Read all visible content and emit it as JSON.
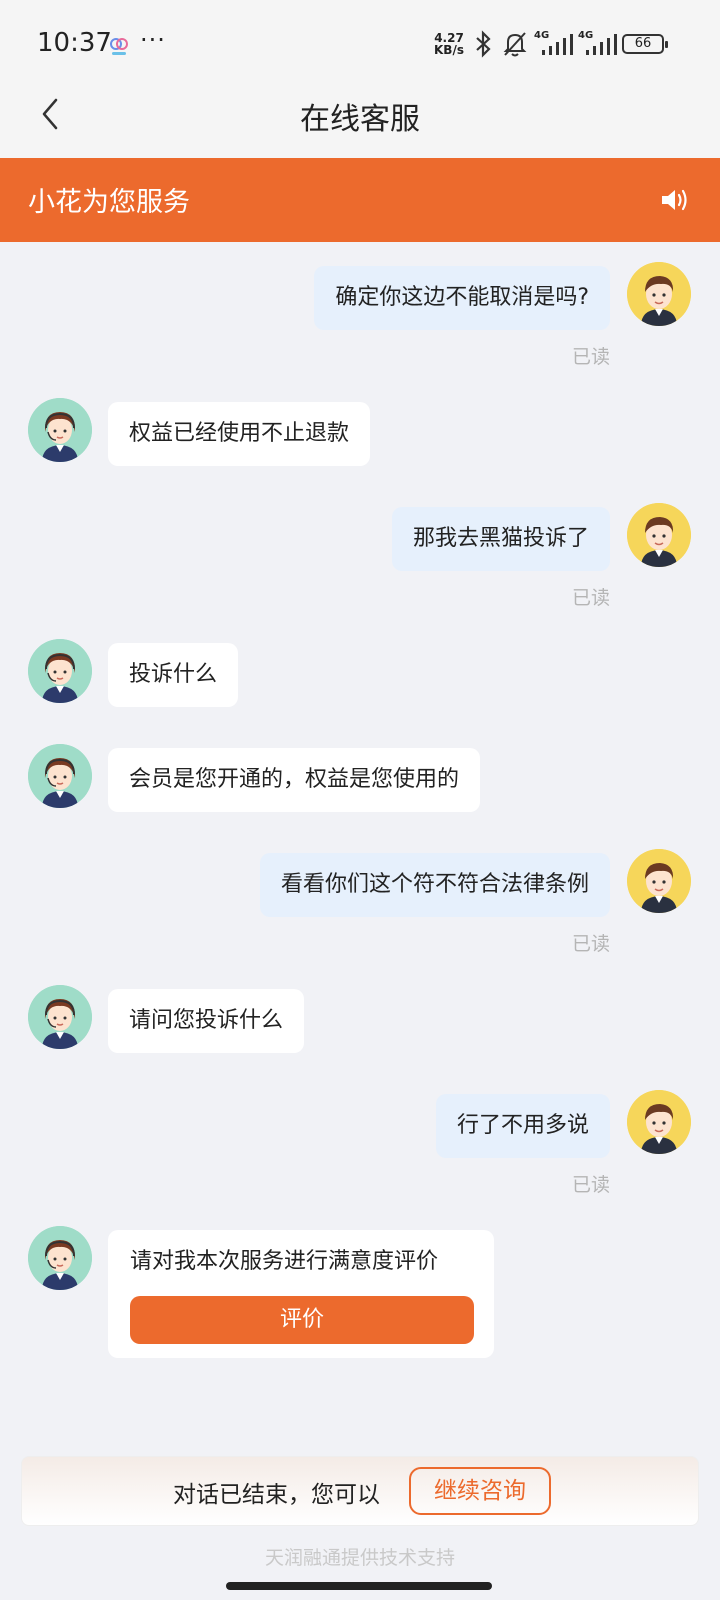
{
  "status_bar": {
    "time": "10:37",
    "dots": "···",
    "net_speed_value": "4.27",
    "net_speed_unit": "KB/s",
    "signal_label_1": "4G",
    "signal_label_2": "4G",
    "battery": "66"
  },
  "nav": {
    "title": "在线客服"
  },
  "banner": {
    "text": "小花为您服务"
  },
  "messages": [
    {
      "role": "user",
      "text": "确定你这边不能取消是吗?",
      "read": "已读"
    },
    {
      "role": "agent",
      "text": "权益已经使用不止退款"
    },
    {
      "role": "user",
      "text": "那我去黑猫投诉了",
      "read": "已读"
    },
    {
      "role": "agent",
      "text": "投诉什么"
    },
    {
      "role": "agent",
      "text": "会员是您开通的，权益是您使用的"
    },
    {
      "role": "user",
      "text": "看看你们这个符不符合法律条例",
      "read": "已读"
    },
    {
      "role": "agent",
      "text": "请问您投诉什么"
    },
    {
      "role": "user",
      "text": "行了不用多说",
      "read": "已读"
    }
  ],
  "evaluation": {
    "prompt": "请对我本次服务进行满意度评价",
    "button": "评价"
  },
  "footer": {
    "ended_text": "对话已结束，您可以",
    "continue_button": "继续咨询",
    "powered_by": "天润融通提供技术支持"
  },
  "colors": {
    "accent": "#ec6a2d",
    "user_bubble": "#e6f0fc",
    "background": "#f1f2f6"
  }
}
